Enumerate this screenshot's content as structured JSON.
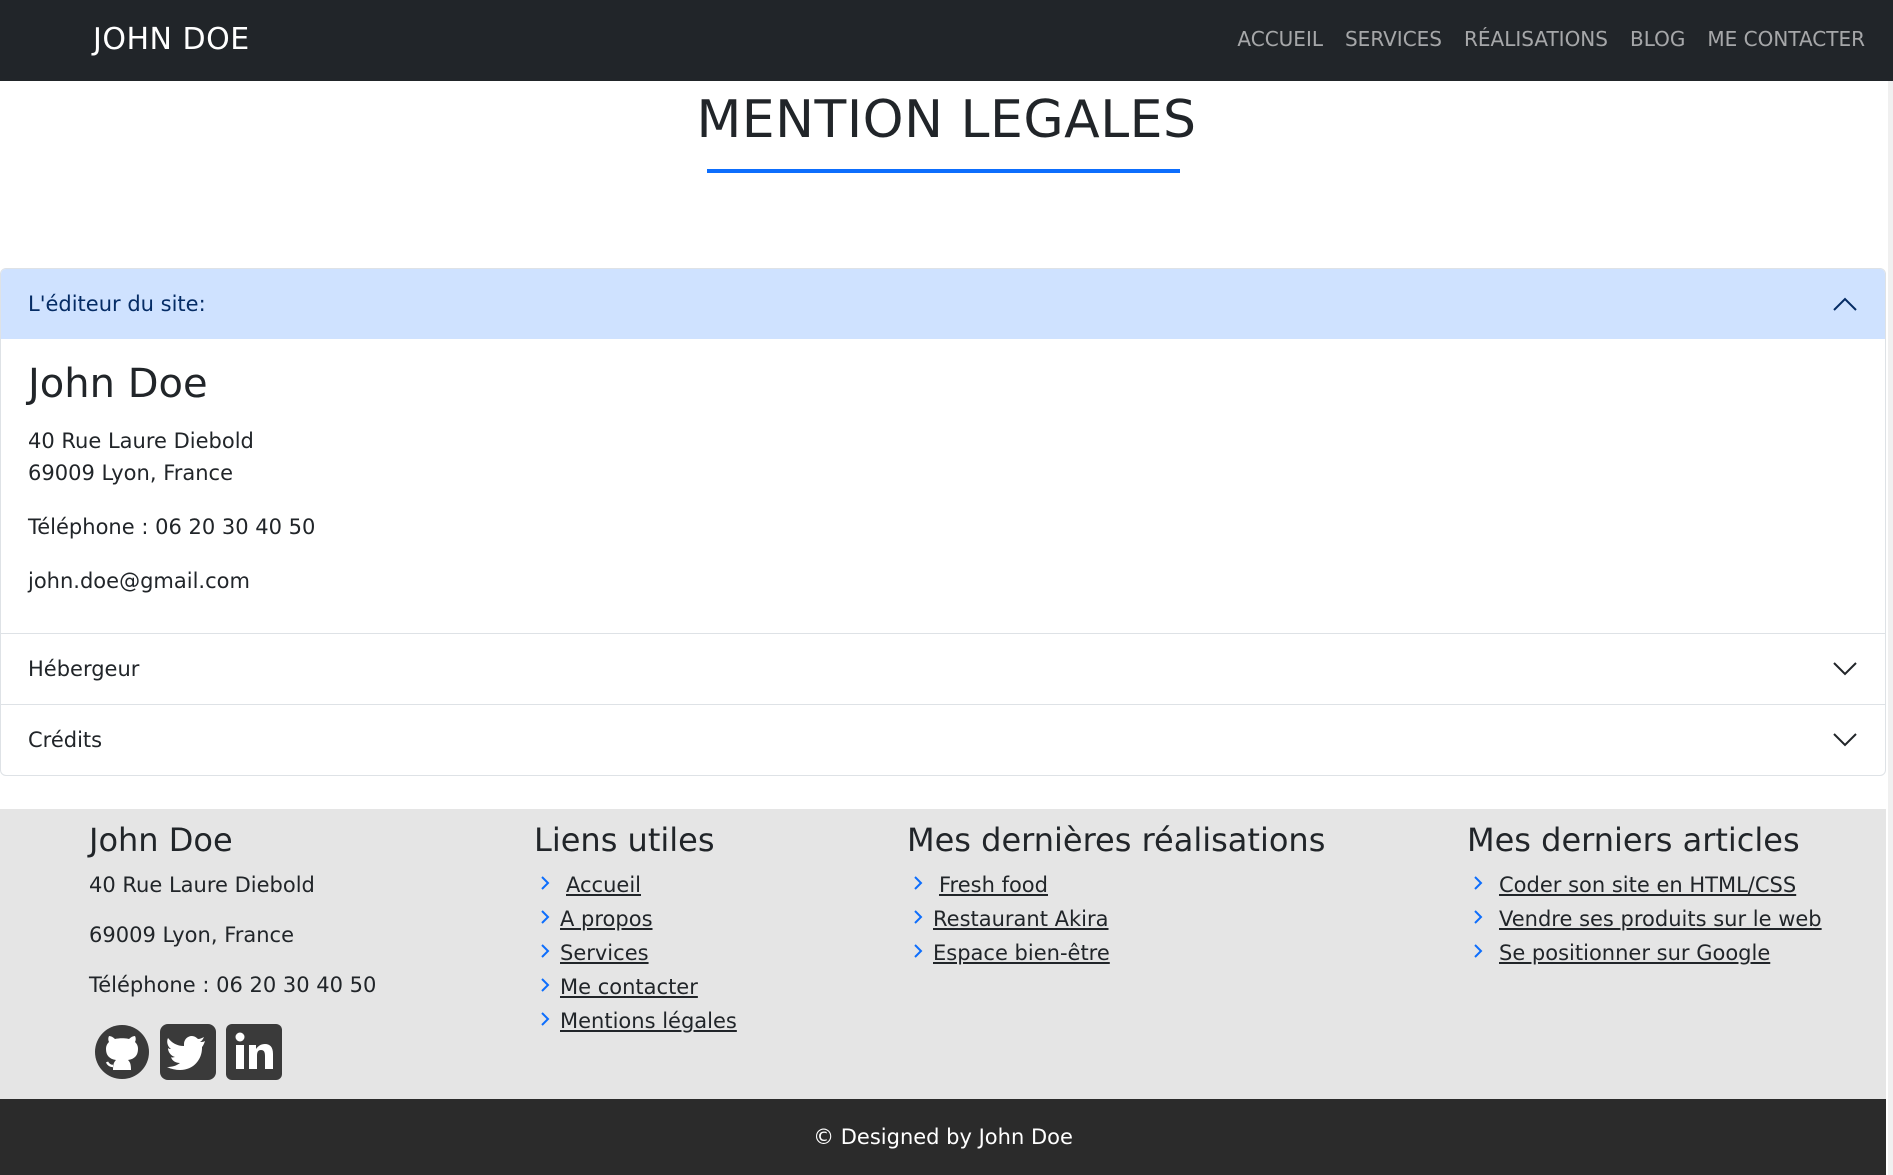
{
  "navbar": {
    "brand": "JOHN DOE",
    "links": [
      "ACCUEIL",
      "SERVICES",
      "RÉALISATIONS",
      "BLOG",
      "ME CONTACTER"
    ]
  },
  "page": {
    "title": "MENTION LEGALES"
  },
  "accordion": {
    "items": [
      {
        "label": "L'éditeur du site:",
        "expanded": true,
        "body": {
          "name": "John Doe",
          "address_line1": "40 Rue Laure Diebold",
          "address_line2": "69009 Lyon, France",
          "phone": "Téléphone : 06 20 30 40 50",
          "email": "john.doe@gmail.com"
        }
      },
      {
        "label": "Hébergeur",
        "expanded": false
      },
      {
        "label": "Crédits",
        "expanded": false
      }
    ]
  },
  "footer": {
    "contact": {
      "title": "John Doe",
      "address_line1": "40 Rue Laure Diebold",
      "address_line2": "69009 Lyon, France",
      "phone": "Téléphone : 06 20 30 40 50",
      "socials": [
        "github-icon",
        "twitter-icon",
        "linkedin-icon"
      ]
    },
    "useful_links": {
      "title": "Liens utiles",
      "items": [
        "Accueil",
        "A propos",
        "Services",
        "Me contacter",
        "Mentions légales"
      ]
    },
    "projects": {
      "title": "Mes dernières réalisations",
      "items": [
        "Fresh food",
        "Restaurant Akira",
        "Espace bien-être"
      ]
    },
    "articles": {
      "title": "Mes derniers articles",
      "items": [
        "Coder son site en HTML/CSS",
        "Vendre ses produits sur le web",
        "Se positionner sur Google"
      ]
    }
  },
  "copyright": "© Designed by John Doe",
  "colors": {
    "navbar_bg": "#212529",
    "accent": "#0d6efd",
    "accordion_open_bg": "#cfe2ff",
    "footer_bg": "#e5e5e5",
    "copyright_bg": "#2b2b2b"
  }
}
